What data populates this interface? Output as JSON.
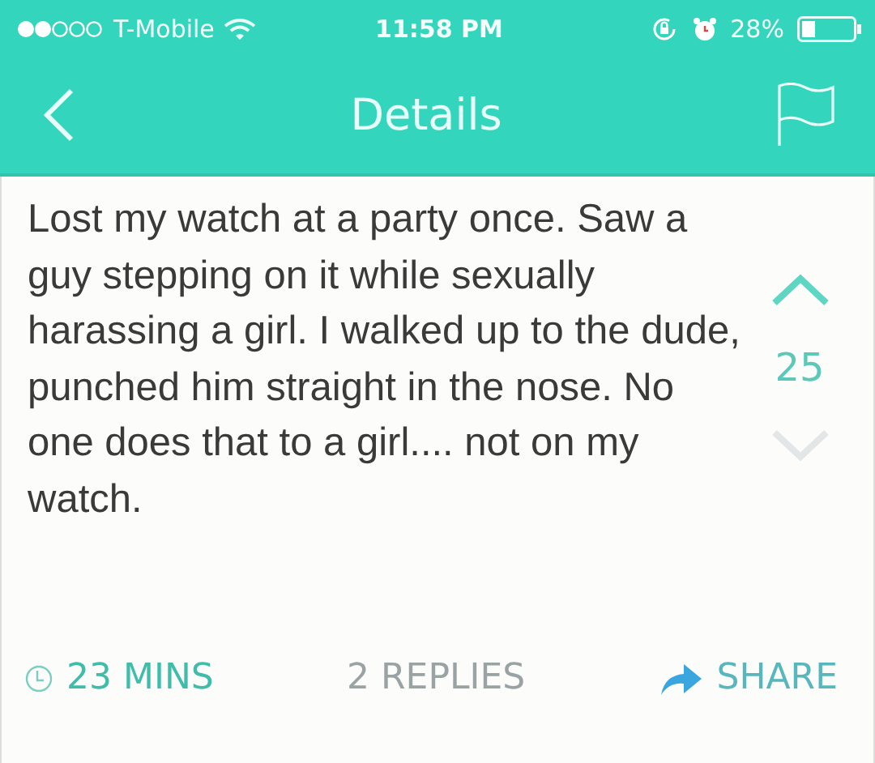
{
  "status_bar": {
    "carrier": "T-Mobile",
    "time": "11:58 PM",
    "battery": "28%"
  },
  "nav": {
    "title": "Details"
  },
  "post": {
    "text": "Lost my watch at a party once. Saw a guy stepping on it while sexually harassing a girl. I walked up to the dude, punched him straight in the nose. No one does that to a girl.... not on my watch.",
    "vote": {
      "up_selected": true,
      "down_selected": false,
      "count": "25"
    }
  },
  "footer": {
    "time": "23 MINS",
    "replies": "2 REPLIES",
    "share": "SHARE"
  }
}
